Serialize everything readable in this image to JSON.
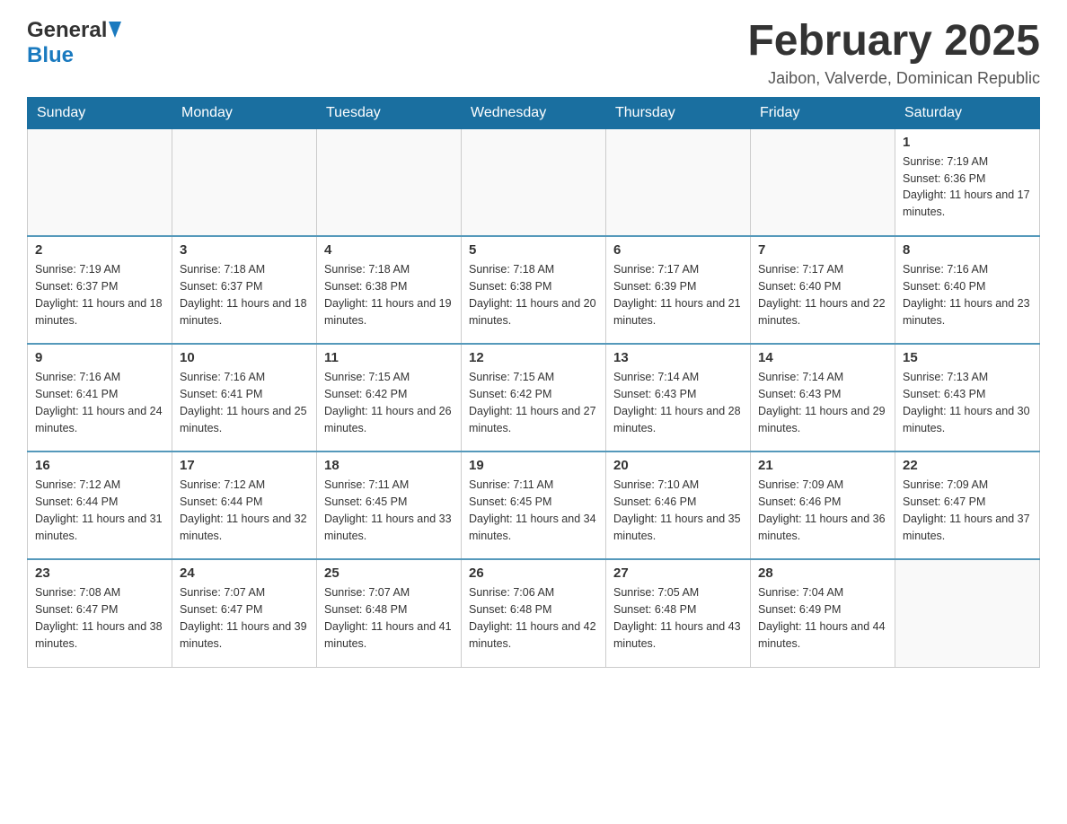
{
  "logo": {
    "general": "General",
    "blue": "Blue"
  },
  "header": {
    "month_year": "February 2025",
    "location": "Jaibon, Valverde, Dominican Republic"
  },
  "weekdays": [
    "Sunday",
    "Monday",
    "Tuesday",
    "Wednesday",
    "Thursday",
    "Friday",
    "Saturday"
  ],
  "weeks": [
    {
      "days": [
        {
          "number": "",
          "info": ""
        },
        {
          "number": "",
          "info": ""
        },
        {
          "number": "",
          "info": ""
        },
        {
          "number": "",
          "info": ""
        },
        {
          "number": "",
          "info": ""
        },
        {
          "number": "",
          "info": ""
        },
        {
          "number": "1",
          "info": "Sunrise: 7:19 AM\nSunset: 6:36 PM\nDaylight: 11 hours and 17 minutes."
        }
      ]
    },
    {
      "days": [
        {
          "number": "2",
          "info": "Sunrise: 7:19 AM\nSunset: 6:37 PM\nDaylight: 11 hours and 18 minutes."
        },
        {
          "number": "3",
          "info": "Sunrise: 7:18 AM\nSunset: 6:37 PM\nDaylight: 11 hours and 18 minutes."
        },
        {
          "number": "4",
          "info": "Sunrise: 7:18 AM\nSunset: 6:38 PM\nDaylight: 11 hours and 19 minutes."
        },
        {
          "number": "5",
          "info": "Sunrise: 7:18 AM\nSunset: 6:38 PM\nDaylight: 11 hours and 20 minutes."
        },
        {
          "number": "6",
          "info": "Sunrise: 7:17 AM\nSunset: 6:39 PM\nDaylight: 11 hours and 21 minutes."
        },
        {
          "number": "7",
          "info": "Sunrise: 7:17 AM\nSunset: 6:40 PM\nDaylight: 11 hours and 22 minutes."
        },
        {
          "number": "8",
          "info": "Sunrise: 7:16 AM\nSunset: 6:40 PM\nDaylight: 11 hours and 23 minutes."
        }
      ]
    },
    {
      "days": [
        {
          "number": "9",
          "info": "Sunrise: 7:16 AM\nSunset: 6:41 PM\nDaylight: 11 hours and 24 minutes."
        },
        {
          "number": "10",
          "info": "Sunrise: 7:16 AM\nSunset: 6:41 PM\nDaylight: 11 hours and 25 minutes."
        },
        {
          "number": "11",
          "info": "Sunrise: 7:15 AM\nSunset: 6:42 PM\nDaylight: 11 hours and 26 minutes."
        },
        {
          "number": "12",
          "info": "Sunrise: 7:15 AM\nSunset: 6:42 PM\nDaylight: 11 hours and 27 minutes."
        },
        {
          "number": "13",
          "info": "Sunrise: 7:14 AM\nSunset: 6:43 PM\nDaylight: 11 hours and 28 minutes."
        },
        {
          "number": "14",
          "info": "Sunrise: 7:14 AM\nSunset: 6:43 PM\nDaylight: 11 hours and 29 minutes."
        },
        {
          "number": "15",
          "info": "Sunrise: 7:13 AM\nSunset: 6:43 PM\nDaylight: 11 hours and 30 minutes."
        }
      ]
    },
    {
      "days": [
        {
          "number": "16",
          "info": "Sunrise: 7:12 AM\nSunset: 6:44 PM\nDaylight: 11 hours and 31 minutes."
        },
        {
          "number": "17",
          "info": "Sunrise: 7:12 AM\nSunset: 6:44 PM\nDaylight: 11 hours and 32 minutes."
        },
        {
          "number": "18",
          "info": "Sunrise: 7:11 AM\nSunset: 6:45 PM\nDaylight: 11 hours and 33 minutes."
        },
        {
          "number": "19",
          "info": "Sunrise: 7:11 AM\nSunset: 6:45 PM\nDaylight: 11 hours and 34 minutes."
        },
        {
          "number": "20",
          "info": "Sunrise: 7:10 AM\nSunset: 6:46 PM\nDaylight: 11 hours and 35 minutes."
        },
        {
          "number": "21",
          "info": "Sunrise: 7:09 AM\nSunset: 6:46 PM\nDaylight: 11 hours and 36 minutes."
        },
        {
          "number": "22",
          "info": "Sunrise: 7:09 AM\nSunset: 6:47 PM\nDaylight: 11 hours and 37 minutes."
        }
      ]
    },
    {
      "days": [
        {
          "number": "23",
          "info": "Sunrise: 7:08 AM\nSunset: 6:47 PM\nDaylight: 11 hours and 38 minutes."
        },
        {
          "number": "24",
          "info": "Sunrise: 7:07 AM\nSunset: 6:47 PM\nDaylight: 11 hours and 39 minutes."
        },
        {
          "number": "25",
          "info": "Sunrise: 7:07 AM\nSunset: 6:48 PM\nDaylight: 11 hours and 41 minutes."
        },
        {
          "number": "26",
          "info": "Sunrise: 7:06 AM\nSunset: 6:48 PM\nDaylight: 11 hours and 42 minutes."
        },
        {
          "number": "27",
          "info": "Sunrise: 7:05 AM\nSunset: 6:48 PM\nDaylight: 11 hours and 43 minutes."
        },
        {
          "number": "28",
          "info": "Sunrise: 7:04 AM\nSunset: 6:49 PM\nDaylight: 11 hours and 44 minutes."
        },
        {
          "number": "",
          "info": ""
        }
      ]
    }
  ]
}
